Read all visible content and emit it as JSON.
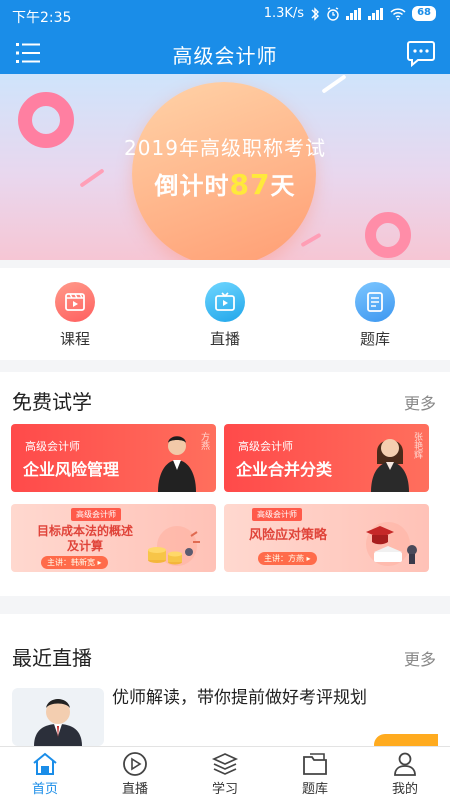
{
  "status_bar": {
    "time": "下午2:35",
    "network_speed": "1.3K/s",
    "battery": "68"
  },
  "header": {
    "title": "高级会计师"
  },
  "banner": {
    "exam_title": "2019年高级职称考试",
    "countdown_prefix": "倒计时",
    "countdown_days": "87",
    "countdown_suffix": "天"
  },
  "quick_entries": [
    {
      "label": "课程",
      "icon": "video-course-icon",
      "color": "#ff6d6d"
    },
    {
      "label": "直播",
      "icon": "tv-live-icon",
      "color": "#33b6f0"
    },
    {
      "label": "题库",
      "icon": "question-bank-icon",
      "color": "#48a9f5"
    }
  ],
  "free_trial": {
    "title": "免费试学",
    "more_label": "更多",
    "cards": [
      {
        "subtitle": "高级会计师",
        "title": "企业风险管理",
        "teacher": "方燕"
      },
      {
        "subtitle": "高级会计师",
        "title": "企业合并分类",
        "teacher": "张艳辉"
      },
      {
        "tag": "高级会计师",
        "title_line1": "目标成本法的概述",
        "title_line2": "及计算",
        "speaker": "主讲：韩新宽 ▸"
      },
      {
        "tag": "高级会计师",
        "title_line1": "风险应对策略",
        "speaker": "主讲：方燕 ▸"
      }
    ]
  },
  "recent_live": {
    "title": "最近直播",
    "more_label": "更多",
    "items": [
      {
        "title": "优师解读，带你提前做好考评规划"
      }
    ]
  },
  "tabs": [
    {
      "label": "首页",
      "icon": "home-icon",
      "active": true
    },
    {
      "label": "直播",
      "icon": "play-icon",
      "active": false
    },
    {
      "label": "学习",
      "icon": "layers-icon",
      "active": false
    },
    {
      "label": "题库",
      "icon": "folder-icon",
      "active": false
    },
    {
      "label": "我的",
      "icon": "person-icon",
      "active": false
    }
  ],
  "colors": {
    "primary": "#1a8de8",
    "accent": "#ff5a4a",
    "countdown": "#ffe93b"
  }
}
